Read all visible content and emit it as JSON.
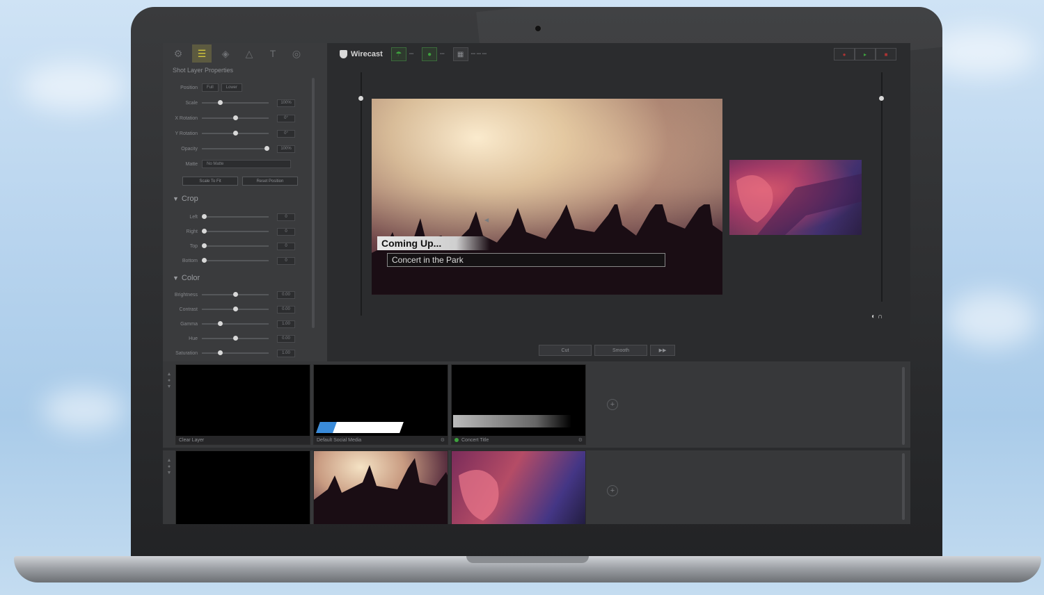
{
  "app": {
    "name": "Wirecast"
  },
  "left_panel": {
    "title": "Shot Layer Properties",
    "tabs": [
      "settings-icon",
      "layers-icon",
      "audio-icon",
      "chroma-icon",
      "text-icon",
      "smart-icon"
    ],
    "position": {
      "label": "Position",
      "buttons": [
        "Full",
        "Lower"
      ]
    },
    "transform_rows": [
      {
        "label": "Scale",
        "value": "100%",
        "level": 0.25
      },
      {
        "label": "X Rotation",
        "value": "0°",
        "level": 0.5
      },
      {
        "label": "Y Rotation",
        "value": "0°",
        "level": 0.5
      },
      {
        "label": "Opacity",
        "value": "100%",
        "level": 1.0
      }
    ],
    "matte": {
      "label": "Matte",
      "value": "No Matte"
    },
    "buttons": [
      "Scale To Fit",
      "Reset Position"
    ],
    "crop": {
      "header": "Crop",
      "rows": [
        {
          "label": "Left",
          "value": "0",
          "level": 0
        },
        {
          "label": "Right",
          "value": "0",
          "level": 0
        },
        {
          "label": "Top",
          "value": "0",
          "level": 0
        },
        {
          "label": "Bottom",
          "value": "0",
          "level": 0
        }
      ]
    },
    "color": {
      "header": "Color",
      "rows": [
        {
          "label": "Brightness",
          "value": "0.00",
          "level": 0.5
        },
        {
          "label": "Contrast",
          "value": "0.00",
          "level": 0.5
        },
        {
          "label": "Gamma",
          "value": "1.00",
          "level": 0.25
        },
        {
          "label": "Hue",
          "value": "0.00",
          "level": 0.5
        },
        {
          "label": "Saturation",
          "value": "1.00",
          "level": 0.25
        }
      ]
    }
  },
  "preview": {
    "lower_third_title": "Coming Up...",
    "lower_third_text": "Concert in the Park"
  },
  "transition": {
    "cut_label": "Cut",
    "smooth_label": "Smooth",
    "go_label": "▶▶"
  },
  "shots": {
    "row1": [
      {
        "name": "Clear Layer"
      },
      {
        "name": "Default Social Media"
      },
      {
        "name": "Concert Title"
      }
    ],
    "row2": [
      {
        "name": ""
      },
      {
        "name": ""
      },
      {
        "name": ""
      }
    ]
  },
  "colors": {
    "accent_green": "#3ea23e",
    "record_red": "#aa3333",
    "tab_active": "#d4c83c"
  }
}
